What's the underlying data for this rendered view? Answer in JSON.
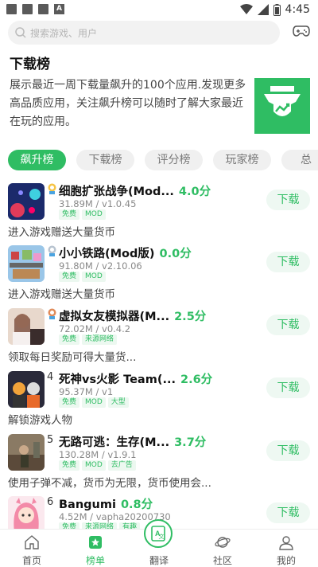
{
  "status_bar": {
    "time": "4:45",
    "notification_a": "A"
  },
  "search": {
    "placeholder": "搜索游戏、用户"
  },
  "header": {
    "title": "下载榜",
    "description": "展示最近一周下载量飙升的100个应用.发现更多高品质应用，关注飙升榜可以随时了解大家最近在玩的应用。"
  },
  "tabs": [
    {
      "label": "飙升榜",
      "active": true
    },
    {
      "label": "下载榜",
      "active": false
    },
    {
      "label": "评分榜",
      "active": false
    },
    {
      "label": "玩家榜",
      "active": false
    },
    {
      "label": "总",
      "active": false
    }
  ],
  "apps": [
    {
      "rank": "",
      "medal": "gold",
      "name": "细胞扩张战争(Mod...",
      "score": "4.0分",
      "meta": "31.89M / v1.0.45",
      "tags": [
        "免费",
        "MOD"
      ],
      "tagline": "进入游戏赠送大量货币",
      "button": "下载"
    },
    {
      "rank": "",
      "medal": "silver",
      "name": "小小铁路(Mod版)",
      "score": "0.0分",
      "meta": "91.80M / v2.10.06",
      "tags": [
        "免费",
        "MOD"
      ],
      "tagline": "进入游戏赠送大量货币",
      "button": "下载"
    },
    {
      "rank": "",
      "medal": "bronze",
      "name": "虚拟女友模拟器(M...",
      "score": "2.5分",
      "meta": "72.02M / v0.4.2",
      "tags": [
        "免费",
        "来源网络"
      ],
      "tagline": "领取每日奖励可得大量货...",
      "button": "下载"
    },
    {
      "rank": "4",
      "medal": "",
      "name": "死神vs火影 Team(...",
      "score": "2.6分",
      "meta": "95.37M / v1",
      "tags": [
        "免费",
        "MOD",
        "大型"
      ],
      "tagline": "解锁游戏人物",
      "button": "下载"
    },
    {
      "rank": "5",
      "medal": "",
      "name": "无路可逃：生存(M...",
      "score": "3.7分",
      "meta": "130.28M / v1.9.1",
      "tags": [
        "免费",
        "MOD",
        "去广告"
      ],
      "tagline": "使用子弹不减，货币为无限，货币使用会...",
      "button": "下载"
    },
    {
      "rank": "6",
      "medal": "",
      "name": "Bangumi",
      "score": "0.8分",
      "meta": "4.52M / vapha20200730",
      "tags": [
        "免费",
        "来源网络",
        "有趣"
      ],
      "tagline": "",
      "button": "下载"
    }
  ],
  "bottom_nav": [
    {
      "label": "首页",
      "icon": "home-icon",
      "active": false
    },
    {
      "label": "榜单",
      "icon": "ranking-icon",
      "active": true
    },
    {
      "label": "翻译",
      "icon": "translate-icon",
      "active": false
    },
    {
      "label": "社区",
      "icon": "planet-icon",
      "active": false
    },
    {
      "label": "我的",
      "icon": "user-icon",
      "active": false
    }
  ],
  "colors": {
    "accent": "#2fbd63",
    "button_bg": "#eef8f2",
    "tab_bg": "#f0f0f0"
  }
}
